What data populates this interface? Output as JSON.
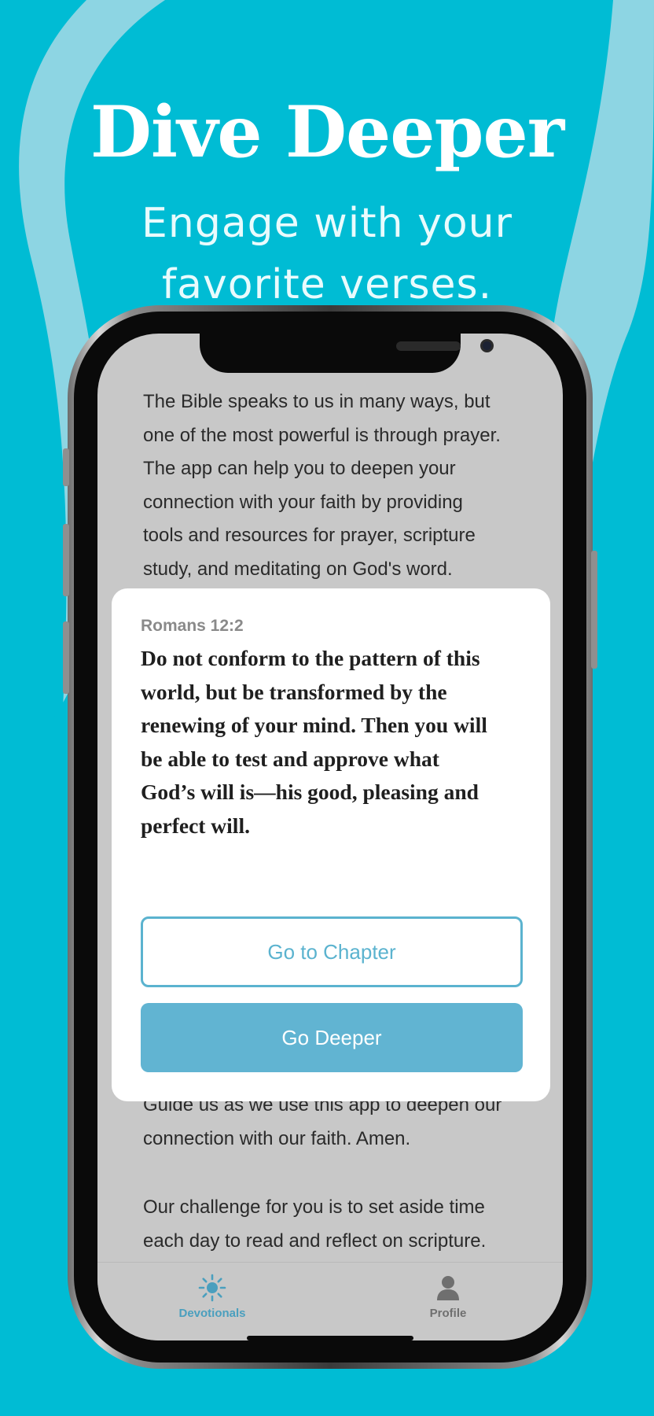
{
  "headline": "Dive Deeper",
  "subline_1": "Engage with your",
  "subline_2": "favorite verses.",
  "colors": {
    "background": "#00bcd4",
    "accent": "#61b4d2",
    "screen_bg": "#c8c8c8"
  },
  "screen": {
    "intro_lines": [
      "The Bible speaks to us in many ways, but",
      "one of the most powerful is through prayer.",
      "The app can help you to deepen your",
      "connection with your faith by providing",
      "tools and resources for prayer, scripture",
      "study, and meditating on God's word."
    ],
    "card": {
      "reference": "Romans 12:2",
      "verse_lines": [
        "Do not conform to the pattern of this",
        "world, but be transformed by the",
        "renewing of your mind. Then you will",
        "be able to test and approve what",
        "God’s will is—his good, pleasing and",
        "perfect will."
      ],
      "go_to_chapter_label": "Go to Chapter",
      "go_deeper_label": "Go Deeper"
    },
    "after_lines": [
      "Guide us as we use this app to deepen our",
      "connection with our faith. Amen."
    ],
    "challenge_lines": [
      "Our challenge for you is to set aside time",
      "each day to read and reflect on scripture."
    ],
    "tabs": [
      {
        "label": "Devotionals",
        "icon": "sun-icon",
        "active": true
      },
      {
        "label": "Profile",
        "icon": "person-icon",
        "active": false
      }
    ]
  }
}
